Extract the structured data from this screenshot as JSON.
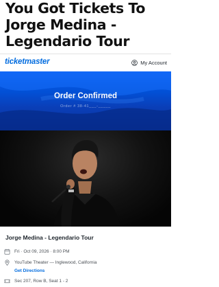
{
  "headline": "You Got Tickets To Jorge Medina - Legendario Tour",
  "header": {
    "logo": "ticketmaster",
    "account_label": "My Account",
    "account_icon": "user-icon"
  },
  "banner": {
    "title": "Order Confirmed",
    "order_number": "Order # 38-41___-_____"
  },
  "hero": {
    "image": "artist-photo"
  },
  "event": {
    "title": "Jorge Medina - Legendario Tour",
    "date": "Fri · Oct 09, 2026 · 8:00 PM",
    "date_icon": "calendar-icon",
    "venue": "YouTube Theater — Inglewood, California",
    "venue_icon": "location-pin-icon",
    "directions_label": "Get Directions",
    "seats": "Sec 207, Row B, Seat 1 - 2",
    "seats_icon": "ticket-icon"
  },
  "colors": {
    "brand": "#026cdf",
    "banner": "#0250d6"
  }
}
